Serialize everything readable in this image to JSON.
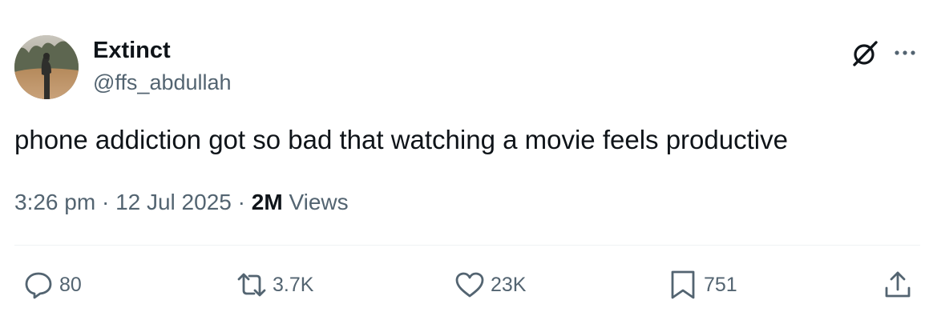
{
  "author": {
    "display_name": "Extinct",
    "handle": "@ffs_abdullah"
  },
  "tweet": {
    "text": "phone addiction got so bad that watching a movie feels productive"
  },
  "meta": {
    "time": "3:26 pm",
    "separator": "·",
    "date": "12 Jul 2025",
    "views_count": "2M",
    "views_label": "Views"
  },
  "actions": {
    "replies": "80",
    "reposts": "3.7K",
    "likes": "23K",
    "bookmarks": "751"
  },
  "icons": {
    "header": [
      "grok-icon",
      "more-icon"
    ],
    "action_bar": [
      "reply-icon",
      "repost-icon",
      "like-icon",
      "bookmark-icon",
      "share-icon"
    ]
  },
  "colors": {
    "text_primary": "#0f1419",
    "text_secondary": "#536471",
    "divider": "#eff3f4",
    "background": "#ffffff"
  }
}
